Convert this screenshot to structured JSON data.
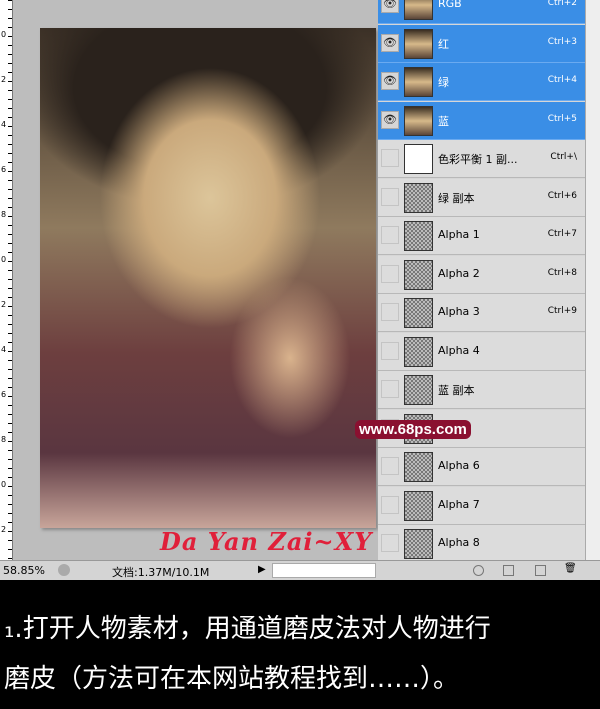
{
  "ruler_labels": [
    "0",
    "2",
    "4",
    "6",
    "8",
    "0",
    "2",
    "4",
    "6",
    "8",
    "0",
    "2"
  ],
  "channels": [
    {
      "name": "RGB",
      "shortcut": "Ctrl+2",
      "selected": true,
      "visible": true
    },
    {
      "name": "红",
      "shortcut": "Ctrl+3",
      "selected": true,
      "visible": true
    },
    {
      "name": "绿",
      "shortcut": "Ctrl+4",
      "selected": true,
      "visible": true
    },
    {
      "name": "蓝",
      "shortcut": "Ctrl+5",
      "selected": true,
      "visible": true
    },
    {
      "name": "色彩平衡 1 副...",
      "shortcut": "Ctrl+\\",
      "selected": false,
      "visible": false
    },
    {
      "name": "绿 副本",
      "shortcut": "Ctrl+6",
      "selected": false,
      "visible": false
    },
    {
      "name": "Alpha 1",
      "shortcut": "Ctrl+7",
      "selected": false,
      "visible": false
    },
    {
      "name": "Alpha 2",
      "shortcut": "Ctrl+8",
      "selected": false,
      "visible": false
    },
    {
      "name": "Alpha 3",
      "shortcut": "Ctrl+9",
      "selected": false,
      "visible": false
    },
    {
      "name": "Alpha 4",
      "shortcut": "",
      "selected": false,
      "visible": false
    },
    {
      "name": "蓝 副本",
      "shortcut": "",
      "selected": false,
      "visible": false
    },
    {
      "name": "",
      "shortcut": "",
      "selected": false,
      "visible": false
    },
    {
      "name": "Alpha 6",
      "shortcut": "",
      "selected": false,
      "visible": false
    },
    {
      "name": "Alpha 7",
      "shortcut": "",
      "selected": false,
      "visible": false
    },
    {
      "name": "Alpha 8",
      "shortcut": "",
      "selected": false,
      "visible": false
    }
  ],
  "status": {
    "zoom": "58.85%",
    "doc": "文档:1.37M/10.1M"
  },
  "watermark": {
    "site": "www.68ps.com",
    "signature": "Da Yan Zai~XY"
  },
  "caption": {
    "line1": "₁.打开人物素材，用通道磨皮法对人物进行",
    "line2": "磨皮（方法可在本网站教程找到……）。"
  },
  "colors": {
    "selected": "#3a8ee6",
    "caption_bg": "#000000"
  }
}
